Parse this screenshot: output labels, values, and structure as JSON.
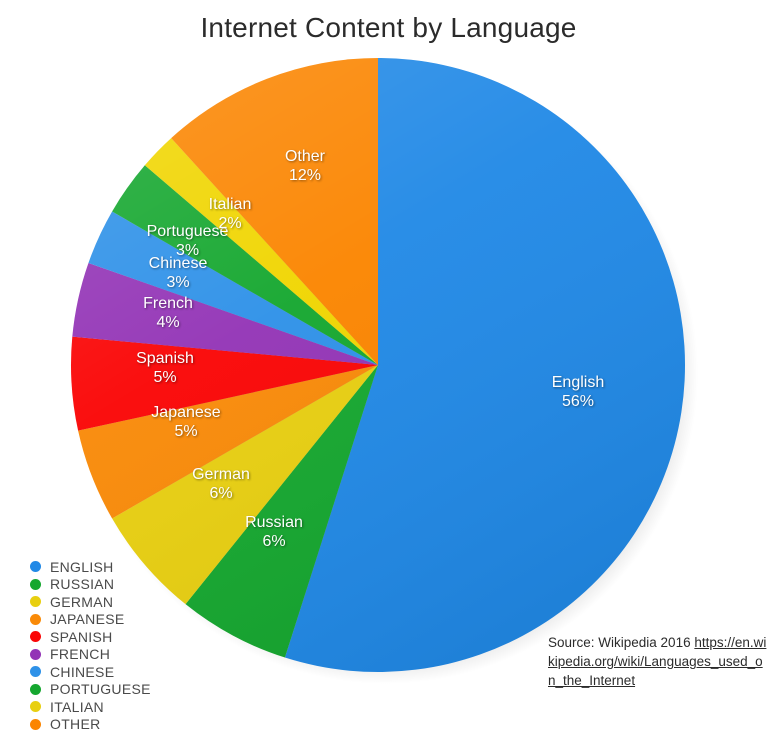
{
  "chart_data": {
    "type": "pie",
    "title": "Internet Content by Language",
    "unit": "%",
    "legend_position": "bottom-left",
    "start_angle_deg": 0,
    "direction": "clockwise",
    "categories": [
      "English",
      "Russian",
      "German",
      "Japanese",
      "Spanish",
      "French",
      "Chinese",
      "Portuguese",
      "Italian",
      "Other"
    ],
    "values": [
      56,
      6,
      6,
      5,
      5,
      4,
      3,
      3,
      2,
      12
    ],
    "labels": [
      {
        "name": "English",
        "value": 56,
        "text": "English",
        "pct_text": "56%",
        "color": "#2189e6"
      },
      {
        "name": "Russian",
        "value": 6,
        "text": "Russian",
        "pct_text": "6%",
        "color": "#15a72f"
      },
      {
        "name": "German",
        "value": 6,
        "text": "German",
        "pct_text": "6%",
        "color": "#e8cf10"
      },
      {
        "name": "Japanese",
        "value": 5,
        "text": "Japanese",
        "pct_text": "5%",
        "color": "#f98a08"
      },
      {
        "name": "Spanish",
        "value": 5,
        "text": "Spanish",
        "pct_text": "5%",
        "color": "#fa0505"
      },
      {
        "name": "French",
        "value": 4,
        "text": "French",
        "pct_text": "4%",
        "color": "#9334b6"
      },
      {
        "name": "Chinese",
        "value": 3,
        "text": "Chinese",
        "pct_text": "3%",
        "color": "#2e91e8"
      },
      {
        "name": "Portuguese",
        "value": 3,
        "text": "Portuguese",
        "pct_text": "3%",
        "color": "#15a72f"
      },
      {
        "name": "Italian",
        "value": 2,
        "text": "Italian",
        "pct_text": "2%",
        "color": "#f0d500"
      },
      {
        "name": "Other",
        "value": 12,
        "text": "Other",
        "pct_text": "12%",
        "color": "#fb8500"
      }
    ]
  },
  "legend": {
    "items": [
      {
        "label": "ENGLISH",
        "color": "#2189e6"
      },
      {
        "label": "RUSSIAN",
        "color": "#15a72f"
      },
      {
        "label": "GERMAN",
        "color": "#e8cf10"
      },
      {
        "label": "JAPANESE",
        "color": "#f98a08"
      },
      {
        "label": "SPANISH",
        "color": "#fa0505"
      },
      {
        "label": "FRENCH",
        "color": "#9334b6"
      },
      {
        "label": "CHINESE",
        "color": "#2e91e8"
      },
      {
        "label": "PORTUGUESE",
        "color": "#15a72f"
      },
      {
        "label": "ITALIAN",
        "color": "#e8cf10"
      },
      {
        "label": "OTHER",
        "color": "#fb8500"
      }
    ]
  },
  "source": {
    "prefix": "Source: Wikipedia 2016 ",
    "url": "https://en.wikipedia.org/wiki/Languages_used_on_the_Internet"
  }
}
